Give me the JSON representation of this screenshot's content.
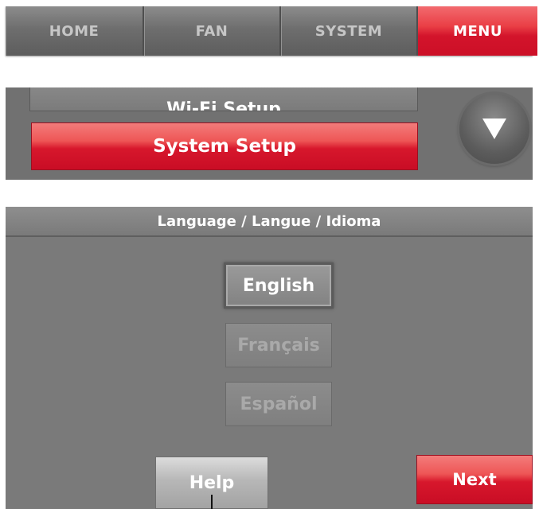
{
  "tabs": [
    {
      "label": "HOME",
      "active": false
    },
    {
      "label": "FAN",
      "active": false
    },
    {
      "label": "SYSTEM",
      "active": false
    },
    {
      "label": "MENU",
      "active": true
    }
  ],
  "menu": {
    "items": [
      {
        "label": "Wi-Fi Setup",
        "partially_visible": true
      },
      {
        "label": "System Setup",
        "selected": true
      }
    ],
    "scroll_icon": "triangle-down-icon"
  },
  "language_screen": {
    "title": "Language / Langue /  Idioma",
    "options": [
      {
        "label": "English",
        "selected": true
      },
      {
        "label": "Français",
        "selected": false
      },
      {
        "label": "Español",
        "selected": false
      }
    ],
    "help_label": "Help",
    "next_label": "Next"
  },
  "colors": {
    "accent_red": "#d7172c",
    "panel_gray": "#7a7a7a",
    "text_white": "#ffffff"
  }
}
